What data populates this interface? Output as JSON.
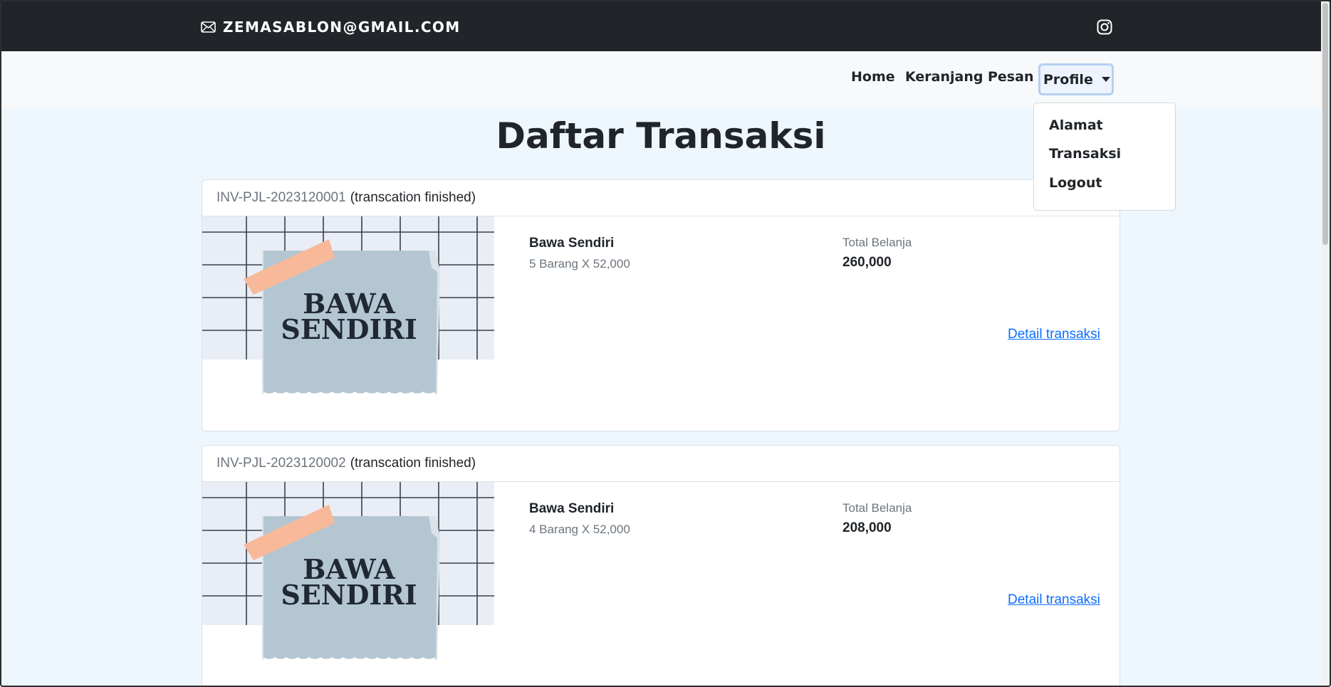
{
  "topbar": {
    "email": "ZEMASABLON@GMAIL.COM",
    "email_icon": "envelope-icon",
    "social_icon": "instagram-icon"
  },
  "navbar": {
    "home": "Home",
    "keranjang": "Keranjang",
    "pesan": "Pesan",
    "profile": "Profile"
  },
  "dropdown": {
    "items": [
      "Alamat",
      "Transaksi",
      "Logout"
    ]
  },
  "page": {
    "title": "Daftar Transaksi"
  },
  "transactions": [
    {
      "invoice": "INV-PJL-2023120001",
      "status": "(transcation finished)",
      "image_text": [
        "BAWA",
        "SENDIRI"
      ],
      "item_name": "Bawa Sendiri",
      "item_qty": "5 Barang X 52,000",
      "total_label": "Total Belanja",
      "total_value": "260,000",
      "detail_link": "Detail transaksi"
    },
    {
      "invoice": "INV-PJL-2023120002",
      "status": "(transcation finished)",
      "image_text": [
        "BAWA",
        "SENDIRI"
      ],
      "item_name": "Bawa Sendiri",
      "item_qty": "4 Barang X 52,000",
      "total_label": "Total Belanja",
      "total_value": "208,000",
      "detail_link": "Detail transaksi"
    }
  ],
  "colors": {
    "topbar_bg": "#212529",
    "navbar_bg": "#f8f9fa",
    "page_bg": "#eef7fd",
    "link": "#0d6efd",
    "paper": "#b4c6d1",
    "tape": "#f8b99b"
  }
}
